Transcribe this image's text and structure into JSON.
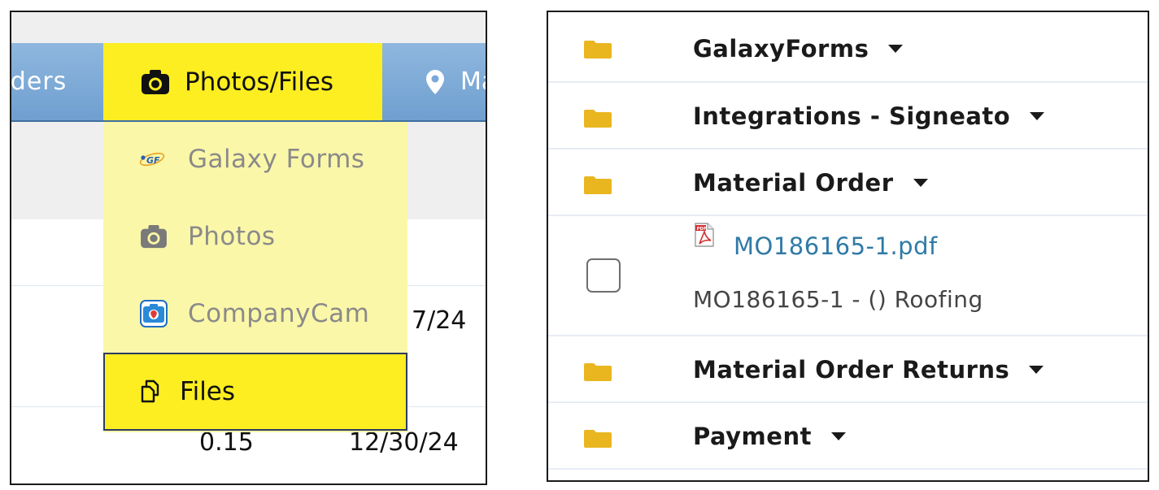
{
  "left": {
    "nav": {
      "orders_label": "rders",
      "photos_files_label": "Photos/Files",
      "map_label": "Ma"
    },
    "dropdown": {
      "galaxy_forms_label": "Galaxy Forms",
      "galaxy_forms_logo": "GF",
      "photos_label": "Photos",
      "companycam_label": "CompanyCam",
      "files_label": "Files"
    },
    "table": {
      "date_partial": "7/24",
      "value": "0.15",
      "date": "12/30/24"
    }
  },
  "right": {
    "folders": [
      {
        "name": "GalaxyForms"
      },
      {
        "name": "Integrations - Signeato"
      },
      {
        "name": "Material Order"
      },
      {
        "name": "Material Order Returns"
      },
      {
        "name": "Payment"
      }
    ],
    "file": {
      "link": "MO186165-1.pdf",
      "description": "MO186165-1 - () Roofing",
      "pdf_badge": "PDF"
    }
  },
  "colors": {
    "nav_blue": "#7aa8d8",
    "highlight_yellow": "#fcee21",
    "dropdown_yellow": "#fbf7a8",
    "folder_yellow": "#e9b620",
    "link_blue": "#2f7aa6"
  },
  "icons": [
    "camera-icon",
    "map-pin-icon",
    "galaxy-forms-logo-icon",
    "companycam-icon",
    "files-icon",
    "folder-icon",
    "caret-down-icon",
    "pdf-icon"
  ]
}
